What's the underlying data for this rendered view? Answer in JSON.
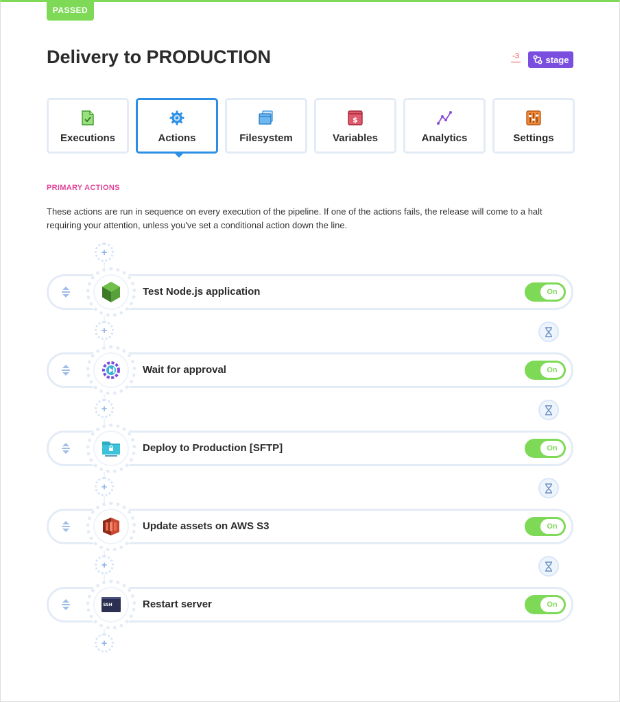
{
  "status": {
    "label": "PASSED",
    "color": "#7ed957"
  },
  "header": {
    "title": "Delivery to PRODUCTION",
    "change_count": "-3",
    "stage_button": "stage",
    "stage_color": "#7a4fe0"
  },
  "tabs": [
    {
      "label": "Executions",
      "icon": "document-check-icon",
      "active": false
    },
    {
      "label": "Actions",
      "icon": "gear-icon",
      "active": true
    },
    {
      "label": "Filesystem",
      "icon": "files-icon",
      "active": false
    },
    {
      "label": "Variables",
      "icon": "dollar-box-icon",
      "active": false
    },
    {
      "label": "Analytics",
      "icon": "line-chart-icon",
      "active": false
    },
    {
      "label": "Settings",
      "icon": "sliders-icon",
      "active": false
    }
  ],
  "section": {
    "label": "PRIMARY ACTIONS",
    "description": "These actions are run in sequence on every execution of the pipeline. If one of the actions fails, the release will come to a halt requiring your attention, unless you've set a conditional action down the line."
  },
  "actions": [
    {
      "name": "Test Node.js application",
      "icon": "nodejs-icon",
      "toggle": "On",
      "enabled": true
    },
    {
      "name": "Wait for approval",
      "icon": "approval-gear-icon",
      "toggle": "On",
      "enabled": true
    },
    {
      "name": "Deploy to Production [SFTP]",
      "icon": "sftp-folder-icon",
      "toggle": "On",
      "enabled": true
    },
    {
      "name": "Update assets on AWS S3",
      "icon": "aws-s3-icon",
      "toggle": "On",
      "enabled": true
    },
    {
      "name": "Restart server",
      "icon": "ssh-terminal-icon",
      "toggle": "On",
      "enabled": true
    }
  ]
}
